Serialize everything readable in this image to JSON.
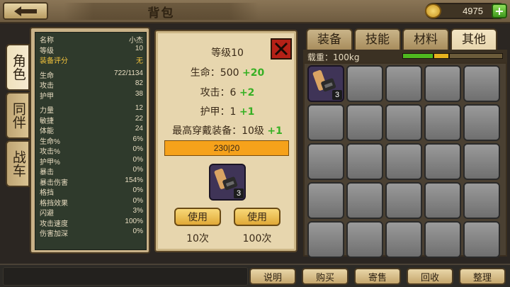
{
  "header": {
    "title": "背包",
    "back_icon": "arrow-left-icon",
    "coins": "4975",
    "coin_icon": "gold-coin-icon",
    "add_icon": "plus-icon"
  },
  "side_tabs": [
    {
      "label": "角色",
      "active": true
    },
    {
      "label": "同伴",
      "active": false
    },
    {
      "label": "战车",
      "active": false
    }
  ],
  "stats": [
    {
      "key": "名称",
      "value": "小杰"
    },
    {
      "key": "等级",
      "value": "10"
    },
    {
      "key": "装备评分",
      "value": "无",
      "highlight": true
    },
    {
      "key": "生命",
      "value": "722/1134"
    },
    {
      "key": "攻击",
      "value": "82"
    },
    {
      "key": "护甲",
      "value": "38"
    },
    {
      "key": "力量",
      "value": "12"
    },
    {
      "key": "敏捷",
      "value": "22"
    },
    {
      "key": "体能",
      "value": "24"
    },
    {
      "key": "生命%",
      "value": "6%"
    },
    {
      "key": "攻击%",
      "value": "0%"
    },
    {
      "key": "护甲%",
      "value": "0%"
    },
    {
      "key": "暴击",
      "value": "0%"
    },
    {
      "key": "暴击伤害",
      "value": "154%"
    },
    {
      "key": "格挡",
      "value": "0%"
    },
    {
      "key": "格挡效果",
      "value": "0%"
    },
    {
      "key": "闪避",
      "value": "3%"
    },
    {
      "key": "攻击速度",
      "value": "100%"
    },
    {
      "key": "伤害加深",
      "value": "0%"
    }
  ],
  "detail": {
    "level": "等级10",
    "hp_label": "生命：500",
    "hp_bonus": "+20",
    "atk_label": "攻击：6",
    "atk_bonus": "+2",
    "armor_label": "护甲：1",
    "armor_bonus": "+1",
    "equip_label": "最高穿戴装备：10级",
    "equip_bonus": "+1",
    "progress_text": "230|20",
    "progress_fraction": 1.0,
    "item_count": "3",
    "close_icon": "close-x-icon",
    "item_icon": "scroll-item-icon",
    "use_buttons": [
      {
        "label": "使用",
        "count": "10次"
      },
      {
        "label": "使用",
        "count": "100次"
      }
    ]
  },
  "inventory": {
    "tabs": [
      {
        "label": "装备",
        "active": false
      },
      {
        "label": "技能",
        "active": false
      },
      {
        "label": "材料",
        "active": false
      },
      {
        "label": "其他",
        "active": true
      }
    ],
    "weight_label": "载重：100kg",
    "weight_colors": [
      "#4fb81f",
      "#e6b21e",
      "#6b5b3a"
    ],
    "first_slot_count": "3",
    "slot_icon": "scroll-item-icon"
  },
  "bottom": {
    "buttons": [
      "说明",
      "购买",
      "寄售",
      "回收",
      "整理"
    ]
  }
}
